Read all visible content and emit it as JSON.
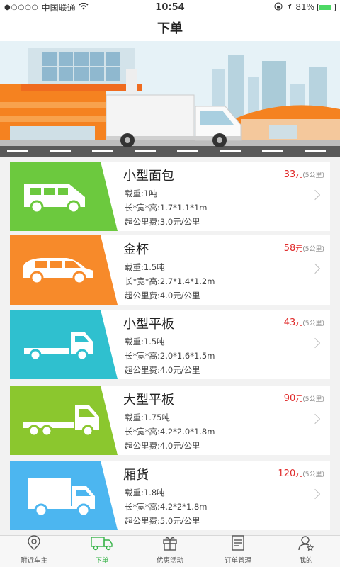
{
  "status_bar": {
    "carrier": "中国联通",
    "time": "10:54",
    "battery_percent": "81%",
    "battery_level": 0.81
  },
  "header": {
    "title": "下单"
  },
  "vehicles": [
    {
      "name": "小型面包",
      "price": "33",
      "price_unit": "元",
      "price_distance": "(5公里)",
      "load": "载重:1吨",
      "dimensions": "长*宽*高:1.7*1.1*1m",
      "extra_fee": "超公里费:3.0元/公里",
      "color": "#6cc93e",
      "icon": "minivan-icon"
    },
    {
      "name": "金杯",
      "price": "58",
      "price_unit": "元",
      "price_distance": "(5公里)",
      "load": "载重:1.5吨",
      "dimensions": "长*宽*高:2.7*1.4*1.2m",
      "extra_fee": "超公里费:4.0元/公里",
      "color": "#f78a2a",
      "icon": "van-icon"
    },
    {
      "name": "小型平板",
      "price": "43",
      "price_unit": "元",
      "price_distance": "(5公里)",
      "load": "载重:1.5吨",
      "dimensions": "长*宽*高:2.0*1.6*1.5m",
      "extra_fee": "超公里费:4.0元/公里",
      "color": "#2fc0cf",
      "icon": "small-flatbed-truck-icon"
    },
    {
      "name": "大型平板",
      "price": "90",
      "price_unit": "元",
      "price_distance": "(5公里)",
      "load": "载重:1.75吨",
      "dimensions": "长*宽*高:4.2*2.0*1.8m",
      "extra_fee": "超公里费:4.0元/公里",
      "color": "#8bc72e",
      "icon": "large-flatbed-truck-icon"
    },
    {
      "name": "厢货",
      "price": "120",
      "price_unit": "元",
      "price_distance": "(5公里)",
      "load": "载重:1.8吨",
      "dimensions": "长*宽*高:4.2*2*1.8m",
      "extra_fee": "超公里费:5.0元/公里",
      "color": "#4cb6f0",
      "icon": "box-truck-icon"
    }
  ],
  "tabs": [
    {
      "label": "附近车主",
      "icon": "location-icon",
      "active": false
    },
    {
      "label": "下单",
      "icon": "truck-icon",
      "active": true
    },
    {
      "label": "优惠活动",
      "icon": "gift-icon",
      "active": false
    },
    {
      "label": "订单管理",
      "icon": "order-list-icon",
      "active": false
    },
    {
      "label": "我的",
      "icon": "profile-icon",
      "active": false
    }
  ],
  "colors": {
    "accent": "#39b34a",
    "price": "#e02b2b"
  }
}
